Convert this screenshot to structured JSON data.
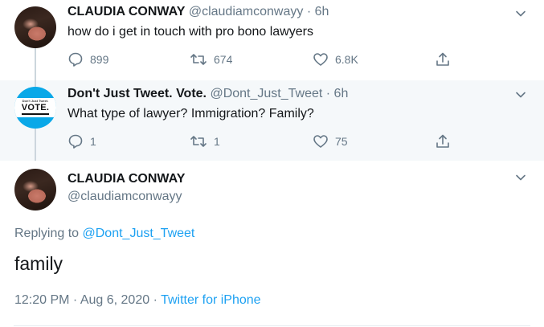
{
  "tweets": [
    {
      "name": "CLAUDIA CONWAY",
      "handle": "@claudiamconwayy",
      "time": "· 6h",
      "text": "how do i get in touch with pro bono lawyers",
      "replies": "899",
      "retweets": "674",
      "likes": "6.8K"
    },
    {
      "name": "Don't Just Tweet. Vote.",
      "handle": "@Dont_Just_Tweet",
      "time": "· 6h",
      "text": "What type of lawyer? Immigration? Family?",
      "replies": "1",
      "retweets": "1",
      "likes": "75",
      "avatar_small_text": "Don't Just Tweet.",
      "avatar_big_text": "VOTE."
    }
  ],
  "main_tweet": {
    "name": "CLAUDIA CONWAY",
    "handle": "@claudiamconwayy",
    "replying_prefix": "Replying to",
    "replying_to": "@Dont_Just_Tweet",
    "text": "family",
    "timestamp": "12:20 PM · Aug 6, 2020",
    "separator": "·",
    "source": "Twitter for iPhone"
  },
  "icons": {
    "reply": "reply-icon",
    "retweet": "retweet-icon",
    "like": "heart-icon",
    "share": "share-icon",
    "menu": "chevron-down-icon"
  },
  "colors": {
    "link": "#1da1f2",
    "secondary": "#657786",
    "thread_bg": "#f5f8fa"
  }
}
